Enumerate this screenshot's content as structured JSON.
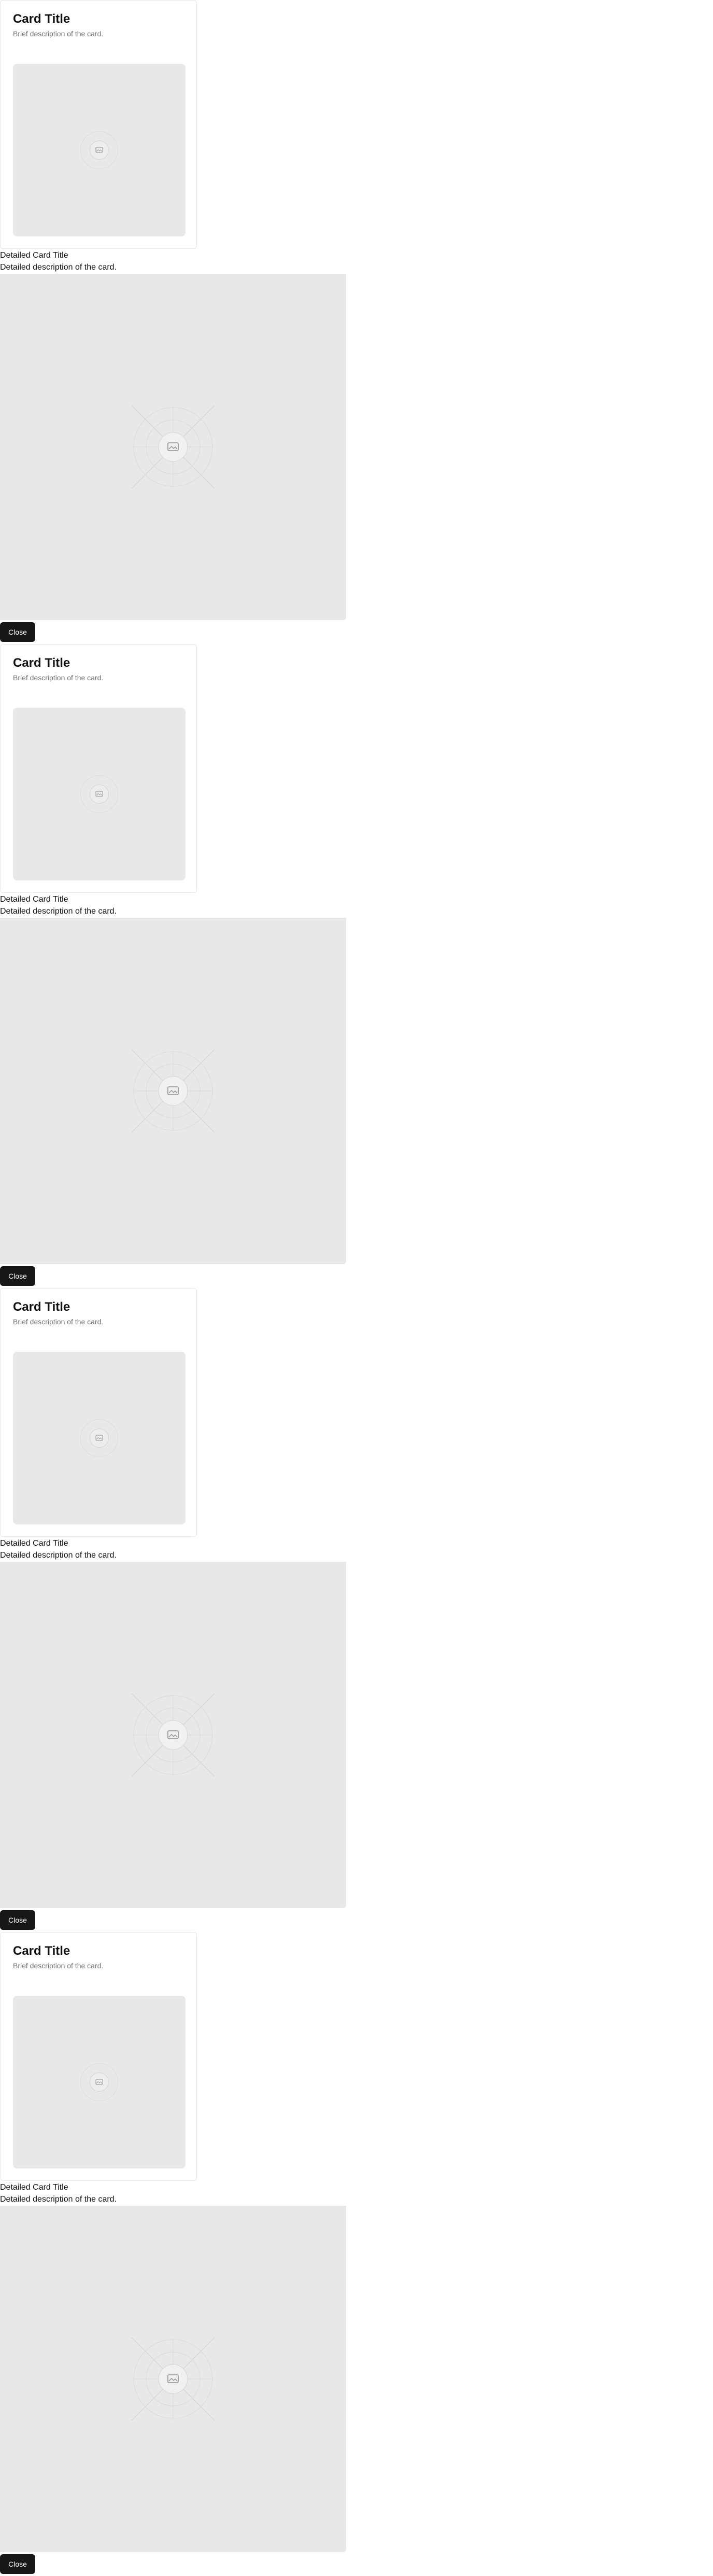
{
  "cards": [
    {
      "title": "Card Title",
      "description": "Brief description of the card.",
      "image_icon": "image-placeholder-icon",
      "detail": {
        "title": "Detailed Card Title",
        "description": "Detailed description of the card.",
        "image_icon": "image-placeholder-icon",
        "close_label": "Close"
      }
    },
    {
      "title": "Card Title",
      "description": "Brief description of the card.",
      "image_icon": "image-placeholder-icon",
      "detail": {
        "title": "Detailed Card Title",
        "description": "Detailed description of the card.",
        "image_icon": "image-placeholder-icon",
        "close_label": "Close"
      }
    },
    {
      "title": "Card Title",
      "description": "Brief description of the card.",
      "image_icon": "image-placeholder-icon",
      "detail": {
        "title": "Detailed Card Title",
        "description": "Detailed description of the card.",
        "image_icon": "image-placeholder-icon",
        "close_label": "Close"
      }
    },
    {
      "title": "Card Title",
      "description": "Brief description of the card.",
      "image_icon": "image-placeholder-icon",
      "detail": {
        "title": "Detailed Card Title",
        "description": "Detailed description of the card.",
        "image_icon": "image-placeholder-icon",
        "close_label": "Close"
      }
    }
  ],
  "colors": {
    "card_border": "#e5e7eb",
    "placeholder_bg": "#e8e8e8",
    "button_bg": "#171717",
    "button_text": "#ffffff",
    "muted_text": "#737373"
  }
}
